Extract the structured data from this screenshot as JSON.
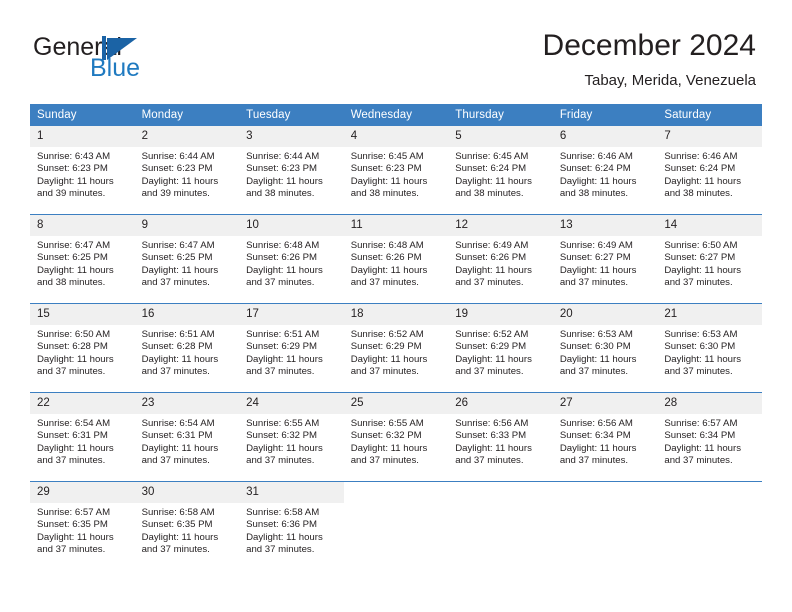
{
  "brand": {
    "name_part1": "General",
    "name_part2": "Blue",
    "mark": "triangle-flag-logo",
    "color_dark": "#231f20",
    "color_blue": "#1f7ac0"
  },
  "header": {
    "title": "December 2024",
    "subtitle": "Tabay, Merida, Venezuela"
  },
  "theme": {
    "header_row_bg": "#3c7fc1",
    "daynum_bg": "#f0f0f0",
    "grid_line": "#3c7fc1",
    "text": "#231f20"
  },
  "calendar": {
    "weekday_headers": [
      "Sunday",
      "Monday",
      "Tuesday",
      "Wednesday",
      "Thursday",
      "Friday",
      "Saturday"
    ],
    "weeks": [
      [
        {
          "day": "1",
          "sunrise": "Sunrise: 6:43 AM",
          "sunset": "Sunset: 6:23 PM",
          "daylight_line1": "Daylight: 11 hours",
          "daylight_line2": "and 39 minutes."
        },
        {
          "day": "2",
          "sunrise": "Sunrise: 6:44 AM",
          "sunset": "Sunset: 6:23 PM",
          "daylight_line1": "Daylight: 11 hours",
          "daylight_line2": "and 39 minutes."
        },
        {
          "day": "3",
          "sunrise": "Sunrise: 6:44 AM",
          "sunset": "Sunset: 6:23 PM",
          "daylight_line1": "Daylight: 11 hours",
          "daylight_line2": "and 38 minutes."
        },
        {
          "day": "4",
          "sunrise": "Sunrise: 6:45 AM",
          "sunset": "Sunset: 6:23 PM",
          "daylight_line1": "Daylight: 11 hours",
          "daylight_line2": "and 38 minutes."
        },
        {
          "day": "5",
          "sunrise": "Sunrise: 6:45 AM",
          "sunset": "Sunset: 6:24 PM",
          "daylight_line1": "Daylight: 11 hours",
          "daylight_line2": "and 38 minutes."
        },
        {
          "day": "6",
          "sunrise": "Sunrise: 6:46 AM",
          "sunset": "Sunset: 6:24 PM",
          "daylight_line1": "Daylight: 11 hours",
          "daylight_line2": "and 38 minutes."
        },
        {
          "day": "7",
          "sunrise": "Sunrise: 6:46 AM",
          "sunset": "Sunset: 6:24 PM",
          "daylight_line1": "Daylight: 11 hours",
          "daylight_line2": "and 38 minutes."
        }
      ],
      [
        {
          "day": "8",
          "sunrise": "Sunrise: 6:47 AM",
          "sunset": "Sunset: 6:25 PM",
          "daylight_line1": "Daylight: 11 hours",
          "daylight_line2": "and 38 minutes."
        },
        {
          "day": "9",
          "sunrise": "Sunrise: 6:47 AM",
          "sunset": "Sunset: 6:25 PM",
          "daylight_line1": "Daylight: 11 hours",
          "daylight_line2": "and 37 minutes."
        },
        {
          "day": "10",
          "sunrise": "Sunrise: 6:48 AM",
          "sunset": "Sunset: 6:26 PM",
          "daylight_line1": "Daylight: 11 hours",
          "daylight_line2": "and 37 minutes."
        },
        {
          "day": "11",
          "sunrise": "Sunrise: 6:48 AM",
          "sunset": "Sunset: 6:26 PM",
          "daylight_line1": "Daylight: 11 hours",
          "daylight_line2": "and 37 minutes."
        },
        {
          "day": "12",
          "sunrise": "Sunrise: 6:49 AM",
          "sunset": "Sunset: 6:26 PM",
          "daylight_line1": "Daylight: 11 hours",
          "daylight_line2": "and 37 minutes."
        },
        {
          "day": "13",
          "sunrise": "Sunrise: 6:49 AM",
          "sunset": "Sunset: 6:27 PM",
          "daylight_line1": "Daylight: 11 hours",
          "daylight_line2": "and 37 minutes."
        },
        {
          "day": "14",
          "sunrise": "Sunrise: 6:50 AM",
          "sunset": "Sunset: 6:27 PM",
          "daylight_line1": "Daylight: 11 hours",
          "daylight_line2": "and 37 minutes."
        }
      ],
      [
        {
          "day": "15",
          "sunrise": "Sunrise: 6:50 AM",
          "sunset": "Sunset: 6:28 PM",
          "daylight_line1": "Daylight: 11 hours",
          "daylight_line2": "and 37 minutes."
        },
        {
          "day": "16",
          "sunrise": "Sunrise: 6:51 AM",
          "sunset": "Sunset: 6:28 PM",
          "daylight_line1": "Daylight: 11 hours",
          "daylight_line2": "and 37 minutes."
        },
        {
          "day": "17",
          "sunrise": "Sunrise: 6:51 AM",
          "sunset": "Sunset: 6:29 PM",
          "daylight_line1": "Daylight: 11 hours",
          "daylight_line2": "and 37 minutes."
        },
        {
          "day": "18",
          "sunrise": "Sunrise: 6:52 AM",
          "sunset": "Sunset: 6:29 PM",
          "daylight_line1": "Daylight: 11 hours",
          "daylight_line2": "and 37 minutes."
        },
        {
          "day": "19",
          "sunrise": "Sunrise: 6:52 AM",
          "sunset": "Sunset: 6:29 PM",
          "daylight_line1": "Daylight: 11 hours",
          "daylight_line2": "and 37 minutes."
        },
        {
          "day": "20",
          "sunrise": "Sunrise: 6:53 AM",
          "sunset": "Sunset: 6:30 PM",
          "daylight_line1": "Daylight: 11 hours",
          "daylight_line2": "and 37 minutes."
        },
        {
          "day": "21",
          "sunrise": "Sunrise: 6:53 AM",
          "sunset": "Sunset: 6:30 PM",
          "daylight_line1": "Daylight: 11 hours",
          "daylight_line2": "and 37 minutes."
        }
      ],
      [
        {
          "day": "22",
          "sunrise": "Sunrise: 6:54 AM",
          "sunset": "Sunset: 6:31 PM",
          "daylight_line1": "Daylight: 11 hours",
          "daylight_line2": "and 37 minutes."
        },
        {
          "day": "23",
          "sunrise": "Sunrise: 6:54 AM",
          "sunset": "Sunset: 6:31 PM",
          "daylight_line1": "Daylight: 11 hours",
          "daylight_line2": "and 37 minutes."
        },
        {
          "day": "24",
          "sunrise": "Sunrise: 6:55 AM",
          "sunset": "Sunset: 6:32 PM",
          "daylight_line1": "Daylight: 11 hours",
          "daylight_line2": "and 37 minutes."
        },
        {
          "day": "25",
          "sunrise": "Sunrise: 6:55 AM",
          "sunset": "Sunset: 6:32 PM",
          "daylight_line1": "Daylight: 11 hours",
          "daylight_line2": "and 37 minutes."
        },
        {
          "day": "26",
          "sunrise": "Sunrise: 6:56 AM",
          "sunset": "Sunset: 6:33 PM",
          "daylight_line1": "Daylight: 11 hours",
          "daylight_line2": "and 37 minutes."
        },
        {
          "day": "27",
          "sunrise": "Sunrise: 6:56 AM",
          "sunset": "Sunset: 6:34 PM",
          "daylight_line1": "Daylight: 11 hours",
          "daylight_line2": "and 37 minutes."
        },
        {
          "day": "28",
          "sunrise": "Sunrise: 6:57 AM",
          "sunset": "Sunset: 6:34 PM",
          "daylight_line1": "Daylight: 11 hours",
          "daylight_line2": "and 37 minutes."
        }
      ],
      [
        {
          "day": "29",
          "sunrise": "Sunrise: 6:57 AM",
          "sunset": "Sunset: 6:35 PM",
          "daylight_line1": "Daylight: 11 hours",
          "daylight_line2": "and 37 minutes."
        },
        {
          "day": "30",
          "sunrise": "Sunrise: 6:58 AM",
          "sunset": "Sunset: 6:35 PM",
          "daylight_line1": "Daylight: 11 hours",
          "daylight_line2": "and 37 minutes."
        },
        {
          "day": "31",
          "sunrise": "Sunrise: 6:58 AM",
          "sunset": "Sunset: 6:36 PM",
          "daylight_line1": "Daylight: 11 hours",
          "daylight_line2": "and 37 minutes."
        },
        null,
        null,
        null,
        null
      ]
    ]
  }
}
